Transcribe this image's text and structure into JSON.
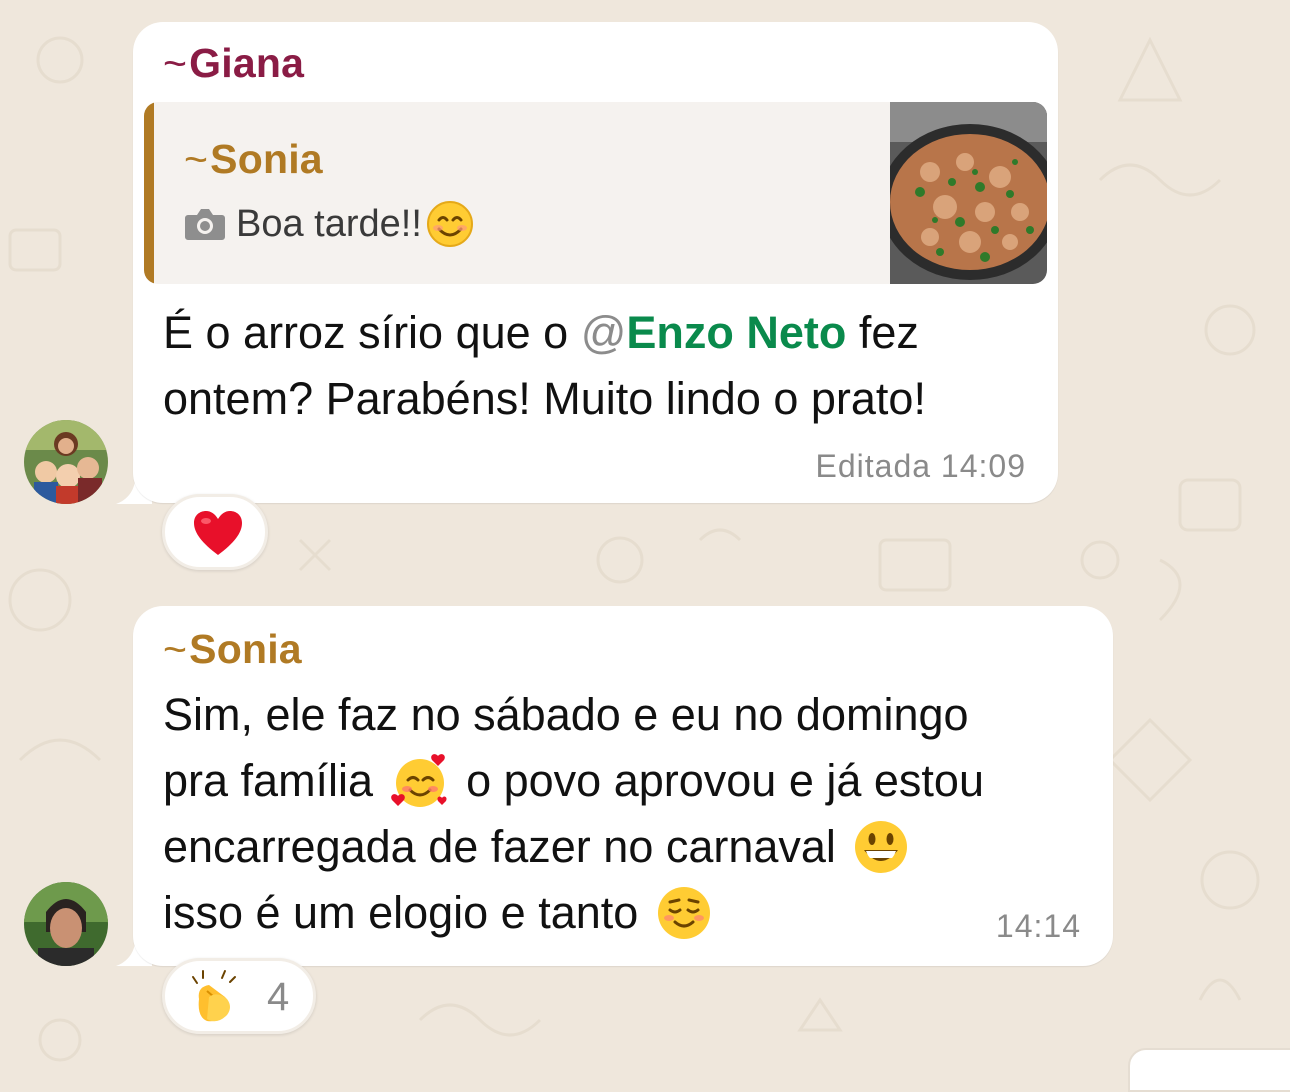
{
  "colors": {
    "giana": "#8a1c45",
    "sonia": "#b07a24",
    "mention": "#0a8a4c",
    "meta": "#8a8a8a",
    "quote_bar": "#b07a24"
  },
  "messages": [
    {
      "sender_tilde": "~",
      "sender": "Giana",
      "quote": {
        "sender_tilde": "~",
        "sender": "Sonia",
        "text": "Boa tarde!!",
        "icon": "camera-icon",
        "emoji": "smiling-face-icon",
        "thumbnail": "rice-dish-thumbnail"
      },
      "line1_before": "É o arroz sírio que o ",
      "mention_at": "@",
      "mention_name": "Enzo Neto",
      "line1_after": " fez",
      "line2": "ontem? Parabéns! Muito lindo o prato!",
      "edited": "Editada",
      "time": "14:09",
      "reaction": {
        "emoji": "red-heart-icon"
      }
    },
    {
      "sender_tilde": "~",
      "sender": "Sonia",
      "line1": "Sim, ele faz no sábado e eu no domingo",
      "line2_before": "pra família ",
      "line2_after": " o povo aprovou e já estou",
      "line3": "encarregada de fazer no carnaval ",
      "line4": "isso é um elogio e tanto ",
      "time": "14:14",
      "reaction": {
        "emoji": "clapping-hands-icon",
        "count": "4"
      }
    }
  ]
}
